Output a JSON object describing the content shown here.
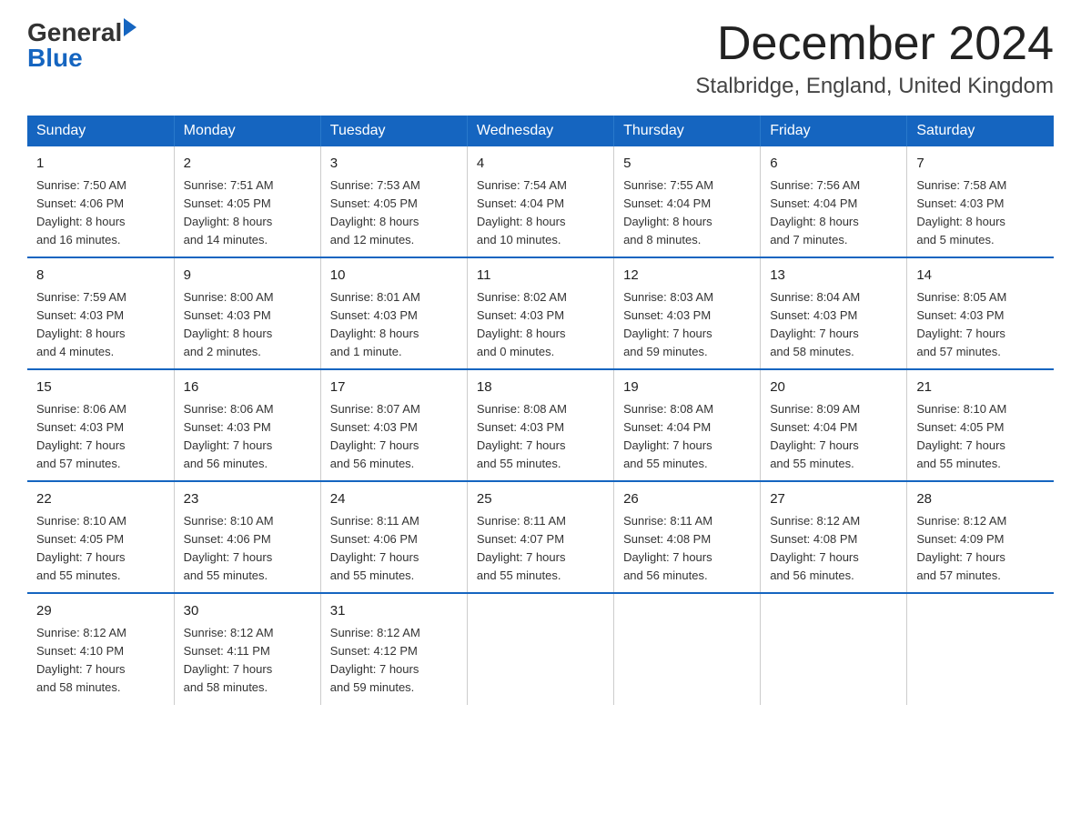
{
  "header": {
    "month_title": "December 2024",
    "location": "Stalbridge, England, United Kingdom"
  },
  "days_of_week": [
    "Sunday",
    "Monday",
    "Tuesday",
    "Wednesday",
    "Thursday",
    "Friday",
    "Saturday"
  ],
  "weeks": [
    [
      {
        "day": "1",
        "info": "Sunrise: 7:50 AM\nSunset: 4:06 PM\nDaylight: 8 hours\nand 16 minutes."
      },
      {
        "day": "2",
        "info": "Sunrise: 7:51 AM\nSunset: 4:05 PM\nDaylight: 8 hours\nand 14 minutes."
      },
      {
        "day": "3",
        "info": "Sunrise: 7:53 AM\nSunset: 4:05 PM\nDaylight: 8 hours\nand 12 minutes."
      },
      {
        "day": "4",
        "info": "Sunrise: 7:54 AM\nSunset: 4:04 PM\nDaylight: 8 hours\nand 10 minutes."
      },
      {
        "day": "5",
        "info": "Sunrise: 7:55 AM\nSunset: 4:04 PM\nDaylight: 8 hours\nand 8 minutes."
      },
      {
        "day": "6",
        "info": "Sunrise: 7:56 AM\nSunset: 4:04 PM\nDaylight: 8 hours\nand 7 minutes."
      },
      {
        "day": "7",
        "info": "Sunrise: 7:58 AM\nSunset: 4:03 PM\nDaylight: 8 hours\nand 5 minutes."
      }
    ],
    [
      {
        "day": "8",
        "info": "Sunrise: 7:59 AM\nSunset: 4:03 PM\nDaylight: 8 hours\nand 4 minutes."
      },
      {
        "day": "9",
        "info": "Sunrise: 8:00 AM\nSunset: 4:03 PM\nDaylight: 8 hours\nand 2 minutes."
      },
      {
        "day": "10",
        "info": "Sunrise: 8:01 AM\nSunset: 4:03 PM\nDaylight: 8 hours\nand 1 minute."
      },
      {
        "day": "11",
        "info": "Sunrise: 8:02 AM\nSunset: 4:03 PM\nDaylight: 8 hours\nand 0 minutes."
      },
      {
        "day": "12",
        "info": "Sunrise: 8:03 AM\nSunset: 4:03 PM\nDaylight: 7 hours\nand 59 minutes."
      },
      {
        "day": "13",
        "info": "Sunrise: 8:04 AM\nSunset: 4:03 PM\nDaylight: 7 hours\nand 58 minutes."
      },
      {
        "day": "14",
        "info": "Sunrise: 8:05 AM\nSunset: 4:03 PM\nDaylight: 7 hours\nand 57 minutes."
      }
    ],
    [
      {
        "day": "15",
        "info": "Sunrise: 8:06 AM\nSunset: 4:03 PM\nDaylight: 7 hours\nand 57 minutes."
      },
      {
        "day": "16",
        "info": "Sunrise: 8:06 AM\nSunset: 4:03 PM\nDaylight: 7 hours\nand 56 minutes."
      },
      {
        "day": "17",
        "info": "Sunrise: 8:07 AM\nSunset: 4:03 PM\nDaylight: 7 hours\nand 56 minutes."
      },
      {
        "day": "18",
        "info": "Sunrise: 8:08 AM\nSunset: 4:03 PM\nDaylight: 7 hours\nand 55 minutes."
      },
      {
        "day": "19",
        "info": "Sunrise: 8:08 AM\nSunset: 4:04 PM\nDaylight: 7 hours\nand 55 minutes."
      },
      {
        "day": "20",
        "info": "Sunrise: 8:09 AM\nSunset: 4:04 PM\nDaylight: 7 hours\nand 55 minutes."
      },
      {
        "day": "21",
        "info": "Sunrise: 8:10 AM\nSunset: 4:05 PM\nDaylight: 7 hours\nand 55 minutes."
      }
    ],
    [
      {
        "day": "22",
        "info": "Sunrise: 8:10 AM\nSunset: 4:05 PM\nDaylight: 7 hours\nand 55 minutes."
      },
      {
        "day": "23",
        "info": "Sunrise: 8:10 AM\nSunset: 4:06 PM\nDaylight: 7 hours\nand 55 minutes."
      },
      {
        "day": "24",
        "info": "Sunrise: 8:11 AM\nSunset: 4:06 PM\nDaylight: 7 hours\nand 55 minutes."
      },
      {
        "day": "25",
        "info": "Sunrise: 8:11 AM\nSunset: 4:07 PM\nDaylight: 7 hours\nand 55 minutes."
      },
      {
        "day": "26",
        "info": "Sunrise: 8:11 AM\nSunset: 4:08 PM\nDaylight: 7 hours\nand 56 minutes."
      },
      {
        "day": "27",
        "info": "Sunrise: 8:12 AM\nSunset: 4:08 PM\nDaylight: 7 hours\nand 56 minutes."
      },
      {
        "day": "28",
        "info": "Sunrise: 8:12 AM\nSunset: 4:09 PM\nDaylight: 7 hours\nand 57 minutes."
      }
    ],
    [
      {
        "day": "29",
        "info": "Sunrise: 8:12 AM\nSunset: 4:10 PM\nDaylight: 7 hours\nand 58 minutes."
      },
      {
        "day": "30",
        "info": "Sunrise: 8:12 AM\nSunset: 4:11 PM\nDaylight: 7 hours\nand 58 minutes."
      },
      {
        "day": "31",
        "info": "Sunrise: 8:12 AM\nSunset: 4:12 PM\nDaylight: 7 hours\nand 59 minutes."
      },
      {
        "day": "",
        "info": ""
      },
      {
        "day": "",
        "info": ""
      },
      {
        "day": "",
        "info": ""
      },
      {
        "day": "",
        "info": ""
      }
    ]
  ],
  "logo": {
    "general": "General",
    "blue": "Blue"
  }
}
